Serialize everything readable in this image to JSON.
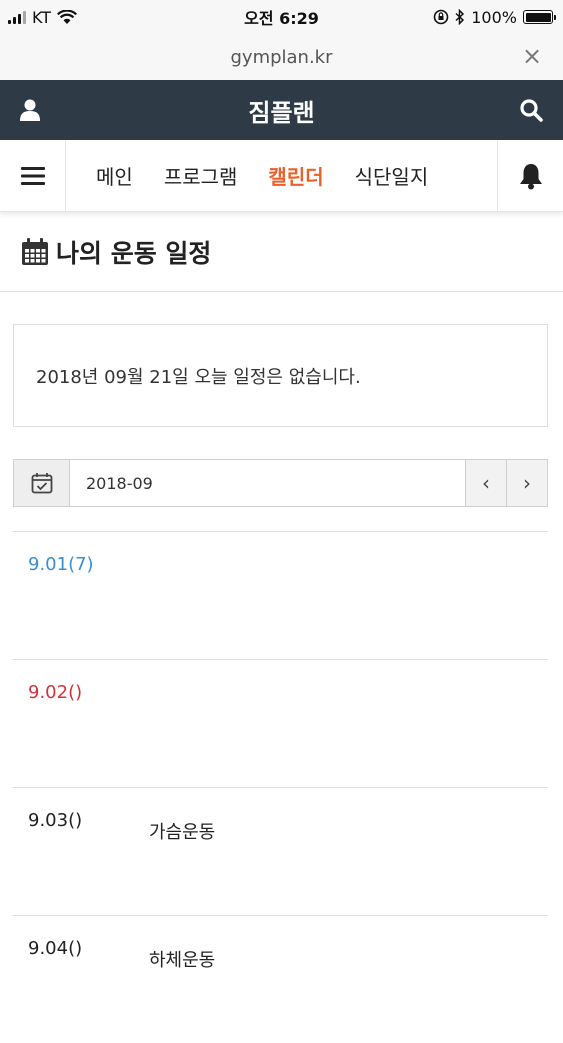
{
  "status_bar": {
    "carrier": "KT",
    "time": "오전 6:29",
    "battery": "100%"
  },
  "url_bar": {
    "url": "gymplan.kr",
    "close_label": "×"
  },
  "header": {
    "title": "짐플랜"
  },
  "nav": {
    "items": [
      {
        "label": "메인"
      },
      {
        "label": "프로그램"
      },
      {
        "label": "캘린더"
      },
      {
        "label": "식단일지"
      }
    ],
    "active_index": 2
  },
  "page": {
    "title": "나의 운동 일정"
  },
  "today": {
    "message": "2018년 09월 21일 오늘 일정은 없습니다."
  },
  "month_selector": {
    "value": "2018-09",
    "prev_label": "‹",
    "next_label": "›"
  },
  "days": [
    {
      "date": "9.01(7)",
      "plan": "",
      "color": "blue"
    },
    {
      "date": "9.02()",
      "plan": "",
      "color": "red"
    },
    {
      "date": "9.03()",
      "plan": "가슴운동",
      "color": "default"
    },
    {
      "date": "9.04()",
      "plan": "하체운동",
      "color": "default"
    }
  ],
  "colors": {
    "header_bg": "#2e3b46",
    "nav_active": "#e8612c",
    "saturday": "#3a8fd0",
    "sunday": "#d0333b"
  }
}
